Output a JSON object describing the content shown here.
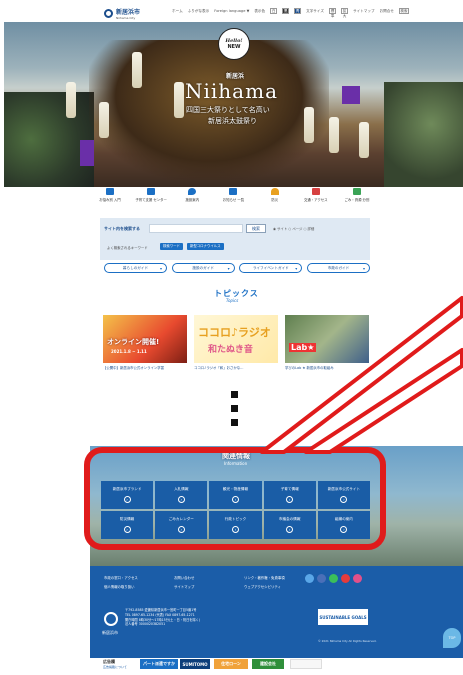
{
  "header": {
    "city_name": "新居浜市",
    "city_sub": "Niihama City",
    "nav": [
      "ホーム",
      "ふりがな表示",
      "Foreign language ▼"
    ],
    "display_label": "表示色",
    "color_toggles": [
      "白",
      "黒",
      "青"
    ],
    "font_label": "文字サイズ",
    "font_toggles": [
      "標準",
      "拡大"
    ],
    "sitemap": "サイトマップ",
    "contact": "お問合せ",
    "search_btn": "検索"
  },
  "hero": {
    "badge_line1": "Hello!",
    "badge_line2": "NEW",
    "city_small": "新居浜",
    "city": "Niihama",
    "line1": "四国三大祭りとして名高い",
    "line2": "新居浜太鼓祭り"
  },
  "iconbar": [
    {
      "label": "お悩み別 入門",
      "color": "#1b6fc4"
    },
    {
      "label": "子育て支援 センター",
      "color": "#1b6fc4"
    },
    {
      "label": "施設案内",
      "color": "#1b6fc4"
    },
    {
      "label": "お知らせ 一覧",
      "color": "#1b6fc4"
    },
    {
      "label": "防災",
      "color": "#e8a020"
    },
    {
      "label": "交通・アクセス",
      "color": "#d64040"
    },
    {
      "label": "ごみ・資源 分別",
      "color": "#3aa356"
    }
  ],
  "search": {
    "title": "サイト内を検索する",
    "placeholder": "",
    "button": "検索",
    "options": "◉ サイト  ○ ページ  ○ 詳細",
    "keyword_label": "よく検索されるキーワード",
    "keywords": [
      "検索ワード",
      "新型コロナウイルス"
    ]
  },
  "categories": [
    "暮らしのガイド",
    "施設のガイド",
    "ライフイベントガイド",
    "市政のガイド"
  ],
  "topics": {
    "title": "トピックス",
    "subtitle": "Topics",
    "cards": [
      {
        "caption": "【公開中】新居浜市公式オンライン学習",
        "headline": "オンライン開催!",
        "date": "2021.1.8 ~ 1.11"
      },
      {
        "caption": "ココロ♪ラジオ「和」おさかな...",
        "headline": "ココロ♪ラジオ",
        "sub": "和たぬき音"
      },
      {
        "caption": "学びのLab ★ 新居浜市の取組み",
        "headline": "Lab★"
      }
    ]
  },
  "related": {
    "title": "関連情報",
    "subtitle": "Information",
    "items": [
      "新居浜市ブランド",
      "入札情報",
      "観光・物産情報",
      "子育て情報",
      "新居浜市公式サイト",
      "防災情報",
      "ごみカレンダー",
      "行政トピック",
      "市議会の情報",
      "組織の案内"
    ]
  },
  "footer": {
    "links": [
      "市政の窓口・アクセス",
      "お問い合わせ",
      "リンク・著作権・免責事項",
      "個人情報の取り扱い",
      "サイトマップ",
      "ウェブアクセシビリティ"
    ],
    "logo_text": "新居浜市",
    "address": [
      "〒792-8585 愛媛県新居浜市一宮町一丁目5番1号",
      "TEL 0897-65-1234 (代表) FAX 0897-65-1271",
      "開庁時間 8時30分〜17時15分(土・日・祝日を除く)",
      "法人番号 3000020382051"
    ],
    "sdgs": "SUSTAINABLE GOALS",
    "copyright": "© 2021 Niihama City All Rights Reserved.",
    "pagetop": "TOP"
  },
  "banners": {
    "label": "広告欄",
    "sublabel": "広告掲載について",
    "items": [
      "パート派遣ですか",
      "SUMITOMO",
      "住宅ローン",
      "建設会社"
    ]
  }
}
